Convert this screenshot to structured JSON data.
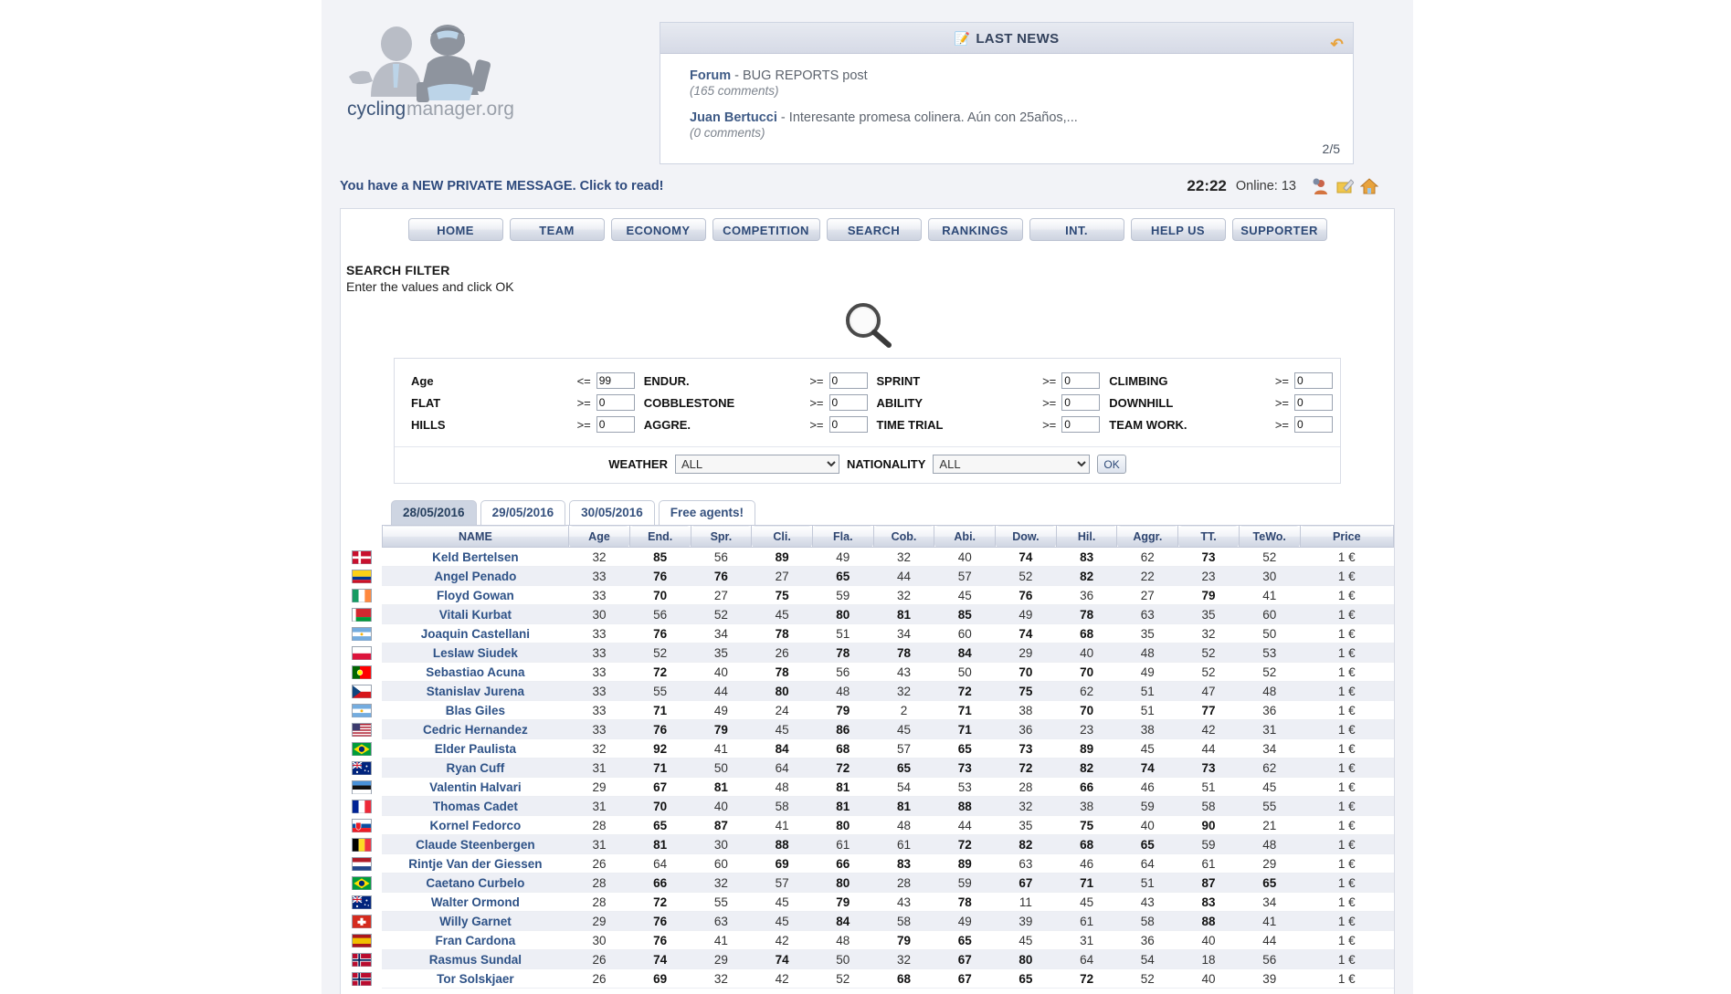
{
  "site": {
    "logo_text_1": "cycling",
    "logo_text_2": "manager.org"
  },
  "news": {
    "title": "LAST NEWS",
    "pencil_icon": "pencil-note-icon",
    "refresh_icon": "refresh-arrow-icon",
    "page_indicator": "2/5",
    "items": [
      {
        "author": "Forum",
        "text": " - BUG REPORTS post",
        "comments": "(165 comments)"
      },
      {
        "author": "Juan Bertucci",
        "text": " - Interesante promesa colinera. Aún con 25años,...",
        "comments": "(0 comments)"
      }
    ]
  },
  "statusbar": {
    "private_message": "You have a NEW PRIVATE MESSAGE. Click to read!",
    "clock": "22:22",
    "online": "Online: 13",
    "icons": [
      "user-profile-icon",
      "pencil-note-icon",
      "home-icon"
    ]
  },
  "nav": {
    "items": [
      {
        "label": "HOME",
        "name": "nav-home"
      },
      {
        "label": "TEAM",
        "name": "nav-team"
      },
      {
        "label": "ECONOMY",
        "name": "nav-economy"
      },
      {
        "label": "COMPETITION",
        "name": "nav-competition"
      },
      {
        "label": "SEARCH",
        "name": "nav-search"
      },
      {
        "label": "RANKINGS",
        "name": "nav-rankings"
      },
      {
        "label": "INT.",
        "name": "nav-int"
      },
      {
        "label": "HELP US",
        "name": "nav-help-us"
      },
      {
        "label": "SUPPORTER",
        "name": "nav-supporter"
      }
    ]
  },
  "search_filter": {
    "title": "SEARCH FILTER",
    "subtitle": "Enter the values and click OK",
    "magnifier_icon": "magnifier-icon",
    "fields": [
      {
        "label": "Age",
        "op": "<=",
        "value": "99"
      },
      {
        "label": "ENDUR.",
        "op": ">=",
        "value": "0"
      },
      {
        "label": "SPRINT",
        "op": ">=",
        "value": "0"
      },
      {
        "label": "CLIMBING",
        "op": ">=",
        "value": "0"
      },
      {
        "label": "FLAT",
        "op": ">=",
        "value": "0"
      },
      {
        "label": "COBBLESTONE",
        "op": ">=",
        "value": "0"
      },
      {
        "label": "ABILITY",
        "op": ">=",
        "value": "0"
      },
      {
        "label": "DOWNHILL",
        "op": ">=",
        "value": "0"
      },
      {
        "label": "HILLS",
        "op": ">=",
        "value": "0"
      },
      {
        "label": "AGGRE.",
        "op": ">=",
        "value": "0"
      },
      {
        "label": "TIME TRIAL",
        "op": ">=",
        "value": "0"
      },
      {
        "label": "TEAM WORK.",
        "op": ">=",
        "value": "0"
      }
    ],
    "weather_label": "WEATHER",
    "weather_value": "ALL",
    "nationality_label": "NATIONALITY",
    "nationality_value": "ALL",
    "ok_label": "OK"
  },
  "tabs": [
    {
      "label": "28/05/2016",
      "active": true
    },
    {
      "label": "29/05/2016",
      "active": false
    },
    {
      "label": "30/05/2016",
      "active": false
    },
    {
      "label": "Free agents!",
      "active": false
    }
  ],
  "table": {
    "columns": [
      "NAME",
      "Age",
      "End.",
      "Spr.",
      "Cli.",
      "Fla.",
      "Cob.",
      "Abi.",
      "Dow.",
      "Hil.",
      "Aggr.",
      "TT.",
      "TeWo.",
      "Price"
    ],
    "rows": [
      {
        "flag": "denmark",
        "name": "Keld Bertelsen",
        "v": [
          32,
          85,
          56,
          89,
          49,
          32,
          40,
          74,
          83,
          62,
          73,
          52
        ],
        "b": [
          false,
          true,
          false,
          true,
          false,
          false,
          false,
          true,
          true,
          false,
          true,
          false
        ],
        "price": "1 €"
      },
      {
        "flag": "colombia",
        "name": "Angel Penado",
        "v": [
          33,
          76,
          76,
          27,
          65,
          44,
          57,
          52,
          82,
          22,
          23,
          30
        ],
        "b": [
          false,
          true,
          true,
          false,
          true,
          false,
          false,
          false,
          true,
          false,
          false,
          false
        ],
        "price": "1 €"
      },
      {
        "flag": "ireland",
        "name": "Floyd Gowan",
        "v": [
          33,
          70,
          27,
          75,
          59,
          32,
          45,
          76,
          36,
          27,
          79,
          41
        ],
        "b": [
          false,
          true,
          false,
          true,
          false,
          false,
          false,
          true,
          false,
          false,
          true,
          false
        ],
        "price": "1 €"
      },
      {
        "flag": "belarus",
        "name": "Vitali Kurbat",
        "v": [
          30,
          56,
          52,
          45,
          80,
          81,
          85,
          49,
          78,
          63,
          35,
          60
        ],
        "b": [
          false,
          false,
          false,
          false,
          true,
          true,
          true,
          false,
          true,
          false,
          false,
          false
        ],
        "price": "1 €"
      },
      {
        "flag": "argentina",
        "name": "Joaquin Castellani",
        "v": [
          33,
          76,
          34,
          78,
          51,
          34,
          60,
          74,
          68,
          35,
          32,
          50
        ],
        "b": [
          false,
          true,
          false,
          true,
          false,
          false,
          false,
          true,
          true,
          false,
          false,
          false
        ],
        "price": "1 €"
      },
      {
        "flag": "poland",
        "name": "Leslaw Siudek",
        "v": [
          33,
          52,
          35,
          26,
          78,
          78,
          84,
          29,
          40,
          48,
          52,
          53
        ],
        "b": [
          false,
          false,
          false,
          false,
          true,
          true,
          true,
          false,
          false,
          false,
          false,
          false
        ],
        "price": "1 €"
      },
      {
        "flag": "portugal",
        "name": "Sebastiao Acuna",
        "v": [
          33,
          72,
          40,
          78,
          56,
          43,
          50,
          70,
          70,
          49,
          52,
          52
        ],
        "b": [
          false,
          true,
          false,
          true,
          false,
          false,
          false,
          true,
          true,
          false,
          false,
          false
        ],
        "price": "1 €"
      },
      {
        "flag": "czech",
        "name": "Stanislav Jurena",
        "v": [
          33,
          55,
          44,
          80,
          48,
          32,
          72,
          75,
          62,
          51,
          47,
          48
        ],
        "b": [
          false,
          false,
          false,
          true,
          false,
          false,
          true,
          true,
          false,
          false,
          false,
          false
        ],
        "price": "1 €"
      },
      {
        "flag": "argentina",
        "name": "Blas Giles",
        "v": [
          33,
          71,
          49,
          24,
          79,
          2,
          71,
          38,
          70,
          51,
          77,
          36
        ],
        "b": [
          false,
          true,
          false,
          false,
          true,
          false,
          true,
          false,
          true,
          false,
          true,
          false
        ],
        "price": "1 €"
      },
      {
        "flag": "usa",
        "name": "Cedric Hernandez",
        "v": [
          33,
          76,
          79,
          45,
          86,
          45,
          71,
          36,
          23,
          38,
          42,
          31
        ],
        "b": [
          false,
          true,
          true,
          false,
          true,
          false,
          true,
          false,
          false,
          false,
          false,
          false
        ],
        "price": "1 €"
      },
      {
        "flag": "brazil",
        "name": "Elder Paulista",
        "v": [
          32,
          92,
          41,
          84,
          68,
          57,
          65,
          73,
          89,
          45,
          44,
          34
        ],
        "b": [
          false,
          true,
          false,
          true,
          true,
          false,
          true,
          true,
          true,
          false,
          false,
          false
        ],
        "price": "1 €"
      },
      {
        "flag": "australia",
        "name": "Ryan Cuff",
        "v": [
          31,
          71,
          50,
          64,
          72,
          65,
          73,
          72,
          82,
          74,
          73,
          62
        ],
        "b": [
          false,
          true,
          false,
          false,
          true,
          true,
          true,
          true,
          true,
          true,
          true,
          false
        ],
        "price": "1 €"
      },
      {
        "flag": "estonia",
        "name": "Valentin Halvari",
        "v": [
          29,
          67,
          81,
          48,
          81,
          54,
          53,
          28,
          66,
          46,
          51,
          45
        ],
        "b": [
          false,
          true,
          true,
          false,
          true,
          false,
          false,
          false,
          true,
          false,
          false,
          false
        ],
        "price": "1 €"
      },
      {
        "flag": "france",
        "name": "Thomas Cadet",
        "v": [
          31,
          70,
          40,
          58,
          81,
          81,
          88,
          32,
          38,
          59,
          58,
          55
        ],
        "b": [
          false,
          true,
          false,
          false,
          true,
          true,
          true,
          false,
          false,
          false,
          false,
          false
        ],
        "price": "1 €"
      },
      {
        "flag": "slovakia",
        "name": "Kornel Fedorco",
        "v": [
          28,
          65,
          87,
          41,
          80,
          48,
          44,
          35,
          75,
          40,
          90,
          21
        ],
        "b": [
          false,
          true,
          true,
          false,
          true,
          false,
          false,
          false,
          true,
          false,
          true,
          false
        ],
        "price": "1 €"
      },
      {
        "flag": "belgium",
        "name": "Claude Steenbergen",
        "v": [
          31,
          81,
          30,
          88,
          61,
          61,
          72,
          82,
          68,
          65,
          59,
          48
        ],
        "b": [
          false,
          true,
          false,
          true,
          false,
          false,
          true,
          true,
          true,
          true,
          false,
          false
        ],
        "price": "1 €"
      },
      {
        "flag": "netherlands",
        "name": "Rintje Van der Giessen",
        "v": [
          26,
          64,
          60,
          69,
          66,
          83,
          89,
          63,
          46,
          64,
          61,
          29
        ],
        "b": [
          false,
          false,
          false,
          true,
          true,
          true,
          true,
          false,
          false,
          false,
          false,
          false
        ],
        "price": "1 €"
      },
      {
        "flag": "brazil",
        "name": "Caetano Curbelo",
        "v": [
          28,
          66,
          32,
          57,
          80,
          28,
          59,
          67,
          71,
          51,
          87,
          65
        ],
        "b": [
          false,
          true,
          false,
          false,
          true,
          false,
          false,
          true,
          true,
          false,
          true,
          true
        ],
        "price": "1 €"
      },
      {
        "flag": "australia",
        "name": "Walter Ormond",
        "v": [
          28,
          72,
          55,
          45,
          79,
          43,
          78,
          11,
          45,
          43,
          83,
          34
        ],
        "b": [
          false,
          true,
          false,
          false,
          true,
          false,
          true,
          false,
          false,
          false,
          true,
          false
        ],
        "price": "1 €"
      },
      {
        "flag": "switzerland",
        "name": "Willy Garnet",
        "v": [
          29,
          76,
          63,
          45,
          84,
          58,
          49,
          39,
          61,
          58,
          88,
          41
        ],
        "b": [
          false,
          true,
          false,
          false,
          true,
          false,
          false,
          false,
          false,
          false,
          true,
          false
        ],
        "price": "1 €"
      },
      {
        "flag": "spain",
        "name": "Fran Cardona",
        "v": [
          30,
          76,
          41,
          42,
          48,
          79,
          65,
          45,
          31,
          36,
          40,
          44
        ],
        "b": [
          false,
          true,
          false,
          false,
          false,
          true,
          true,
          false,
          false,
          false,
          false,
          false
        ],
        "price": "1 €"
      },
      {
        "flag": "norway",
        "name": "Rasmus Sundal",
        "v": [
          26,
          74,
          29,
          74,
          50,
          32,
          67,
          80,
          64,
          54,
          18,
          56
        ],
        "b": [
          false,
          true,
          false,
          true,
          false,
          false,
          true,
          true,
          false,
          false,
          false,
          false
        ],
        "price": "1 €"
      },
      {
        "flag": "norway",
        "name": "Tor Solskjaer",
        "v": [
          26,
          69,
          32,
          42,
          52,
          68,
          67,
          65,
          72,
          52,
          40,
          39
        ],
        "b": [
          false,
          true,
          false,
          false,
          false,
          true,
          true,
          true,
          true,
          false,
          false,
          false
        ],
        "price": "1 €"
      }
    ]
  }
}
